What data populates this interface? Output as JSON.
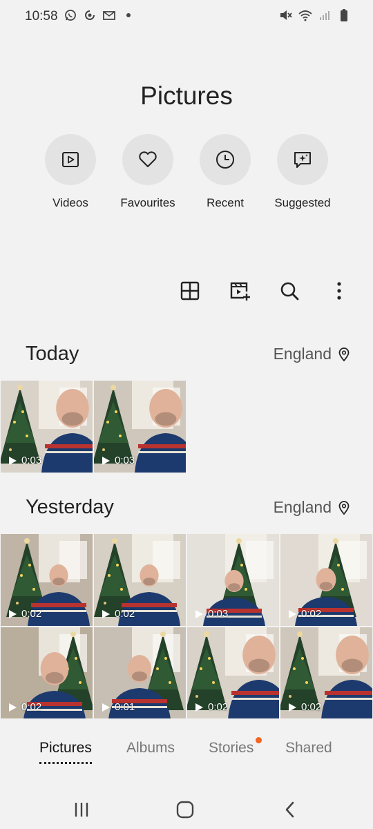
{
  "status_bar": {
    "time": "10:58",
    "left_icons": [
      "whatsapp-icon",
      "app-notification-icon",
      "mail-icon",
      "dot-icon"
    ],
    "right_icons": [
      "mute-icon",
      "wifi-icon",
      "signal-icon",
      "battery-icon"
    ]
  },
  "page": {
    "title": "Pictures"
  },
  "quick_actions": [
    {
      "label": "Videos",
      "icon": "video-icon"
    },
    {
      "label": "Favourites",
      "icon": "heart-icon"
    },
    {
      "label": "Recent",
      "icon": "clock-icon"
    },
    {
      "label": "Suggested",
      "icon": "sparkle-chat-icon"
    }
  ],
  "toolbar": {
    "icons": [
      "grid-view-icon",
      "create-movie-icon",
      "search-icon",
      "more-options-icon"
    ]
  },
  "sections": [
    {
      "title": "Today",
      "location": "England",
      "items": [
        {
          "duration": "0:03"
        },
        {
          "duration": "0:03"
        }
      ]
    },
    {
      "title": "Yesterday",
      "location": "England",
      "items": [
        {
          "duration": "0:02"
        },
        {
          "duration": "0:02"
        },
        {
          "duration": "0:03"
        },
        {
          "duration": "0:02"
        },
        {
          "duration": "0:02"
        },
        {
          "duration": "0:01"
        },
        {
          "duration": "0:02"
        },
        {
          "duration": "0:02"
        }
      ]
    }
  ],
  "bottom_tabs": [
    {
      "label": "Pictures",
      "active": true
    },
    {
      "label": "Albums",
      "active": false
    },
    {
      "label": "Stories",
      "active": false,
      "badge": true
    },
    {
      "label": "Shared",
      "active": false
    }
  ],
  "colors": {
    "badge": "#f26522",
    "background": "#f2f2f2"
  },
  "nav_bar": [
    "recent-apps-icon",
    "home-icon",
    "back-icon"
  ]
}
